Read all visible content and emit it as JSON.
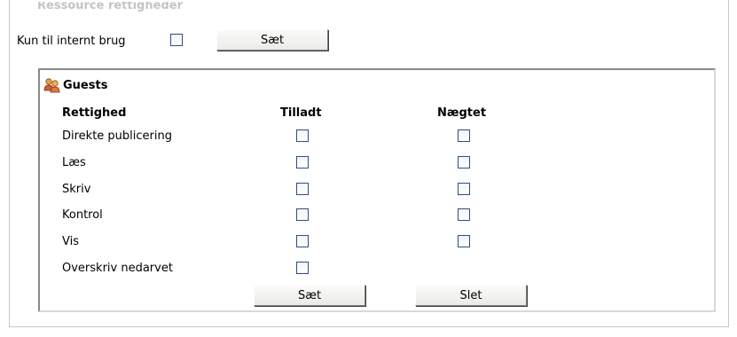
{
  "section": {
    "title": "Ressource rettigheder"
  },
  "internal": {
    "label": "Kun til internt brug",
    "checked": false,
    "set_button": "Sæt"
  },
  "group": {
    "icon": "users-icon",
    "name": "Guests"
  },
  "table": {
    "columns": [
      "Rettighed",
      "Tilladt",
      "Nægtet"
    ],
    "rows": [
      {
        "label": "Direkte publicering",
        "allowed": false,
        "denied": false
      },
      {
        "label": "Læs",
        "allowed": false,
        "denied": false
      },
      {
        "label": "Skriv",
        "allowed": false,
        "denied": false
      },
      {
        "label": "Kontrol",
        "allowed": false,
        "denied": false
      },
      {
        "label": "Vis",
        "allowed": false,
        "denied": false
      },
      {
        "label": "Overskriv nedarvet",
        "allowed": false
      }
    ]
  },
  "buttons": {
    "set": "Sæt",
    "delete": "Slet"
  },
  "colors": {
    "checkbox_border": "#2b4f86",
    "title_faded": "#c4c4c4"
  }
}
